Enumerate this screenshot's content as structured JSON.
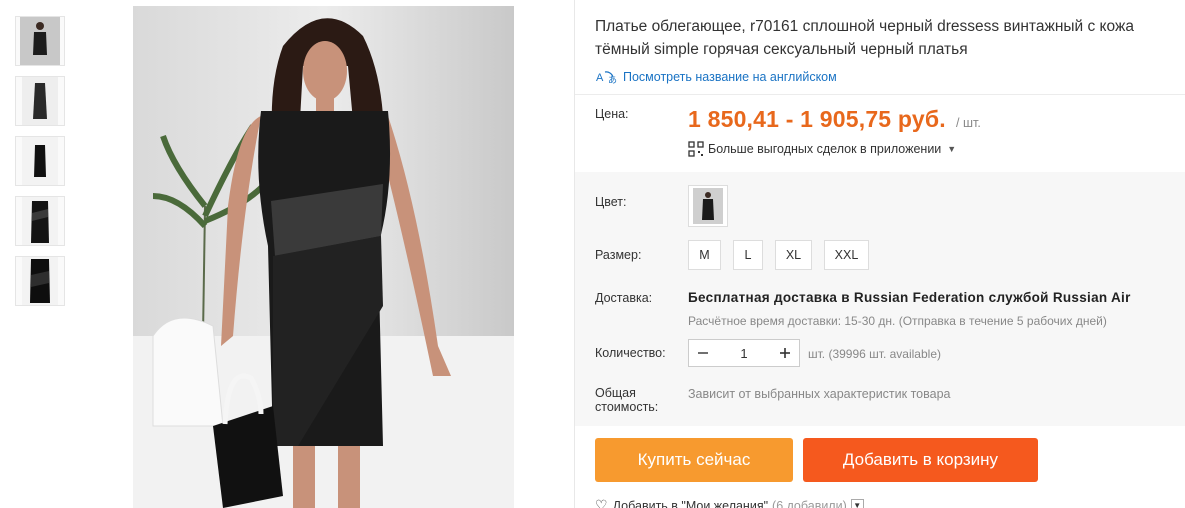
{
  "product": {
    "title_line1": "Платье облегающее, r70161 сплошной черный dressess винтажный с кожа",
    "title_line2": "тёмный simple горячая сексуальный черный платья",
    "translate_link": "Посмотреть название на английском"
  },
  "price": {
    "label": "Цена:",
    "value": "1 850,41 - 1 905,75 руб.",
    "unit": "/ шт.",
    "app_deals": "Больше выгодных сделок в приложении"
  },
  "color": {
    "label": "Цвет:"
  },
  "size": {
    "label": "Размер:",
    "options": [
      "M",
      "L",
      "XL",
      "XXL"
    ]
  },
  "delivery": {
    "label": "Доставка:",
    "main": "Бесплатная доставка в Russian Federation службой Russian Air",
    "sub": "Расчётное время доставки: 15-30 дн. (Отправка в течение 5 рабочих дней)"
  },
  "quantity": {
    "label": "Количество:",
    "value": "1",
    "available": "шт. (39996 шт. available)"
  },
  "total": {
    "label_line1": "Общая",
    "label_line2": "стоимость:",
    "value": "Зависит от выбранных характеристик товара"
  },
  "actions": {
    "buy_now": "Купить сейчас",
    "add_to_cart": "Добавить в корзину"
  },
  "wishlist": {
    "label": "Добавить в \"Мои желания\"",
    "count": "(6 добавили)"
  },
  "colors": {
    "price": "#e8681c",
    "buy_button": "#f79a2f",
    "cart_button": "#f5591e",
    "link": "#1a73c4"
  }
}
